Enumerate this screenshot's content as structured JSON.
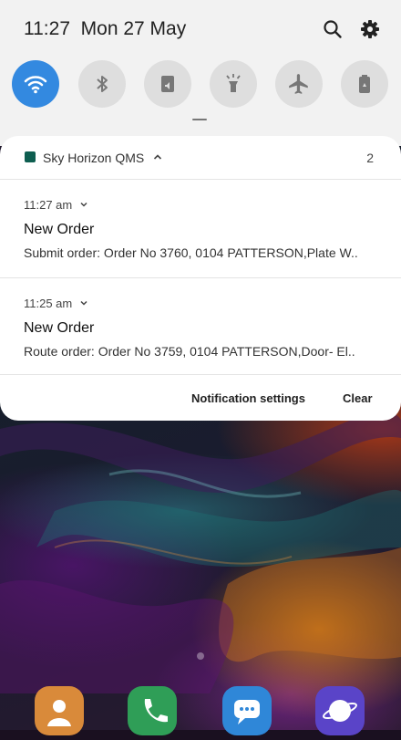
{
  "status_bar": {
    "time": "11:27",
    "date": "Mon 27 May",
    "icons": [
      "search-icon",
      "gear-icon"
    ]
  },
  "quick_settings": [
    {
      "name": "wifi-icon",
      "active": true
    },
    {
      "name": "bluetooth-icon",
      "active": false
    },
    {
      "name": "sound-icon",
      "active": false
    },
    {
      "name": "flashlight-icon",
      "active": false
    },
    {
      "name": "airplane-mode-icon",
      "active": false
    },
    {
      "name": "battery-saver-icon",
      "active": false
    }
  ],
  "notification_group": {
    "app_name": "Sky Horizon QMS",
    "count": "2",
    "notifications": [
      {
        "time": "11:27 am",
        "title": "New Order",
        "body": "Submit order: Order No 3760, 0104 PATTERSON,Plate W.."
      },
      {
        "time": "11:25 am",
        "title": "New Order",
        "body": "Route order: Order No 3759, 0104 PATTERSON,Door- El.."
      }
    ],
    "actions": {
      "settings": "Notification settings",
      "clear": "Clear"
    }
  },
  "colors": {
    "accent": "#3389e0",
    "panel": "#f2f2f2",
    "card": "#ffffff",
    "app_icon": "#0e5e50"
  },
  "dock": [
    "contacts-icon",
    "phone-icon",
    "messages-icon",
    "internet-icon"
  ]
}
